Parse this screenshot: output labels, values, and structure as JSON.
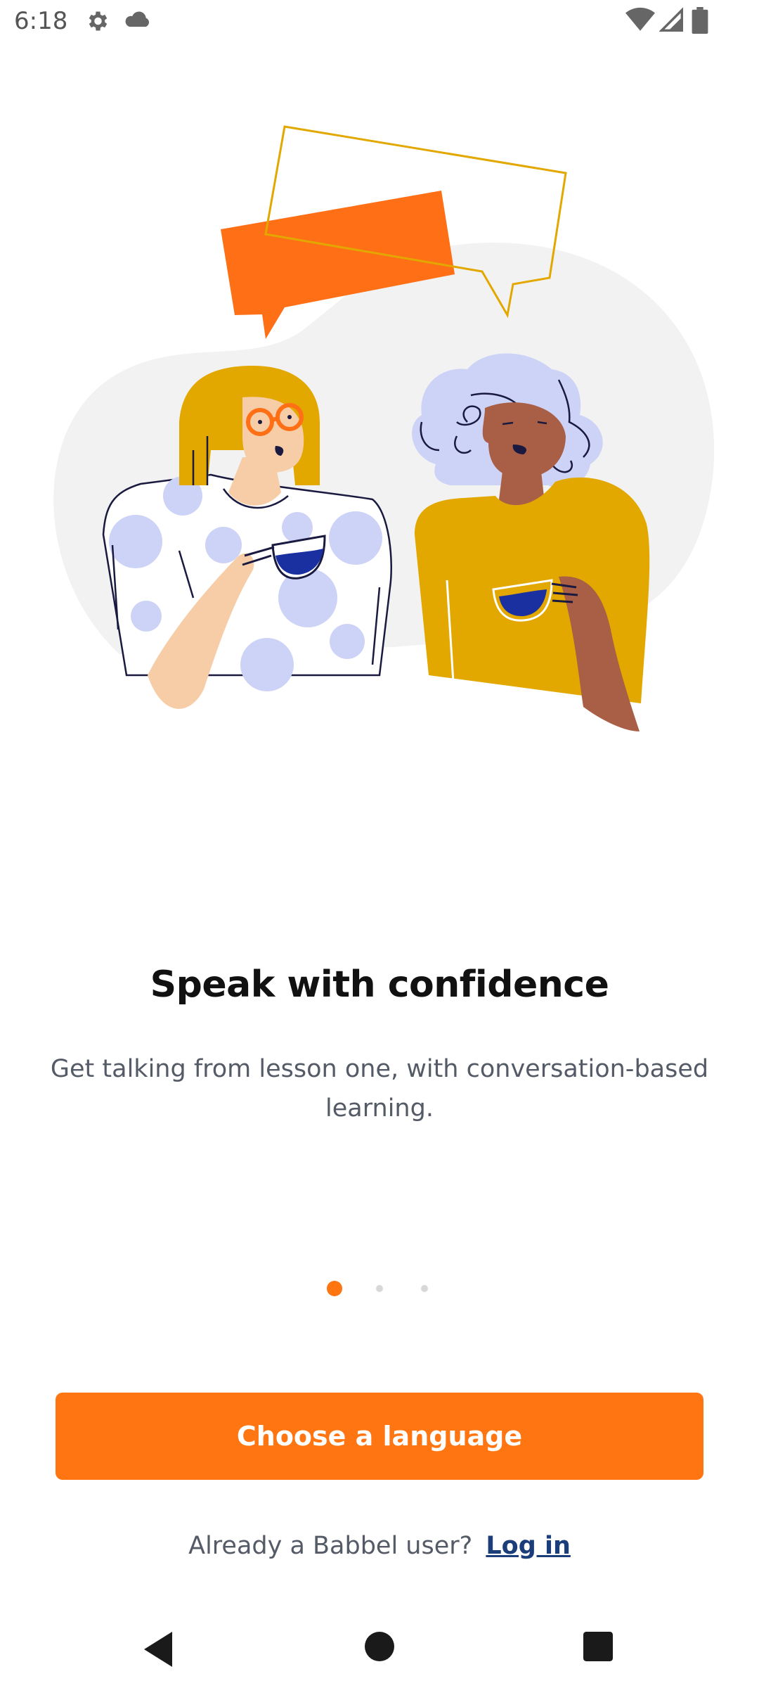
{
  "status_bar": {
    "time": "6:18",
    "left_icons": [
      "gear-icon",
      "cloud-icon"
    ],
    "right_icons": [
      "wifi-icon",
      "signal-icon",
      "battery-icon"
    ]
  },
  "illustration": {
    "description_icon": "two-people-talking-illustration",
    "colors": {
      "orange": "#ff6f16",
      "mustard": "#e2a800",
      "lavender": "#cdd3f7",
      "navy": "#1a2fa0",
      "skin_light": "#f6cda6",
      "skin_dark": "#a95f45",
      "background_blob": "#f2f2f2"
    }
  },
  "content": {
    "headline": "Speak with confidence",
    "subtitle": "Get talking from lesson one, with conversation-based learning."
  },
  "pager": {
    "page_count": 3,
    "active_index": 0,
    "active_color": "#ff7511"
  },
  "cta": {
    "label": "Choose a language",
    "color": "#ff7511"
  },
  "login": {
    "prompt": "Already a Babbel user?",
    "link_label": "Log in"
  },
  "nav_bar": {
    "buttons": [
      "back-icon",
      "home-icon",
      "recents-icon"
    ]
  }
}
